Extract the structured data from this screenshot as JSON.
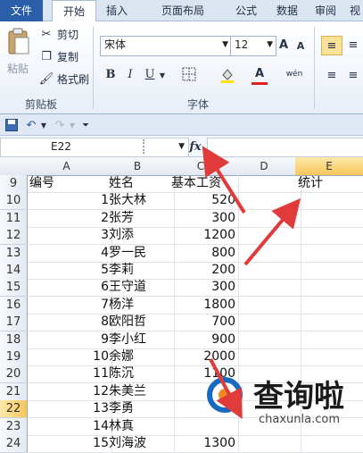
{
  "tabs": [
    "文件",
    "开始",
    "插入",
    "页面布局",
    "公式",
    "数据",
    "审阅",
    "视"
  ],
  "clipboard": {
    "paste": "粘贴",
    "cut": "剪切",
    "copy": "复制",
    "format_painter": "格式刷",
    "group": "剪贴板"
  },
  "font": {
    "name": "宋体",
    "size": "12",
    "bold": "B",
    "italic": "I",
    "underline": "U",
    "font_color_glyph": "A",
    "grow": "A",
    "shrink": "A",
    "group": "字体",
    "phonetic": "wén"
  },
  "qat": {
    "save": "save-icon",
    "undo": "undo-icon",
    "redo": "redo-icon"
  },
  "formula_bar": {
    "name_box": "E22",
    "fx": "fx",
    "content": ""
  },
  "columns": [
    "A",
    "B",
    "C",
    "D",
    "E"
  ],
  "selected_column": "E",
  "selected_row": "22",
  "rows": [
    {
      "n": "9",
      "a": "编号",
      "b": "姓名",
      "c": "基本工资",
      "e": "统计"
    },
    {
      "n": "10",
      "a": "1",
      "b": "张大林",
      "c": "520",
      "e": ""
    },
    {
      "n": "11",
      "a": "2",
      "b": "张芳",
      "c": "300",
      "e": ""
    },
    {
      "n": "12",
      "a": "3",
      "b": "刘添",
      "c": "1200",
      "e": ""
    },
    {
      "n": "13",
      "a": "4",
      "b": "罗一民",
      "c": "800",
      "e": ""
    },
    {
      "n": "14",
      "a": "5",
      "b": "李莉",
      "c": "200",
      "e": ""
    },
    {
      "n": "15",
      "a": "6",
      "b": "王守道",
      "c": "300",
      "e": ""
    },
    {
      "n": "16",
      "a": "7",
      "b": "杨洋",
      "c": "1800",
      "e": ""
    },
    {
      "n": "17",
      "a": "8",
      "b": "欧阳哲",
      "c": "700",
      "e": ""
    },
    {
      "n": "18",
      "a": "9",
      "b": "李小红",
      "c": "900",
      "e": ""
    },
    {
      "n": "19",
      "a": "10",
      "b": "余娜",
      "c": "2000",
      "e": ""
    },
    {
      "n": "20",
      "a": "11",
      "b": "陈沉",
      "c": "1100",
      "e": ""
    },
    {
      "n": "21",
      "a": "12",
      "b": "朱美兰",
      "c": "",
      "e": ""
    },
    {
      "n": "22",
      "a": "13",
      "b": "李勇",
      "c": "",
      "e": ""
    },
    {
      "n": "23",
      "a": "14",
      "b": "林真",
      "c": "",
      "e": ""
    },
    {
      "n": "24",
      "a": "15",
      "b": "刘海波",
      "c": "1300",
      "e": ""
    }
  ],
  "watermark": {
    "text_cn": "查询啦",
    "text_url": "chaxunla.com"
  },
  "colors": {
    "arrow": "#e03a3a",
    "accent": "#2a5ea8",
    "selection": "#f6c65a"
  }
}
